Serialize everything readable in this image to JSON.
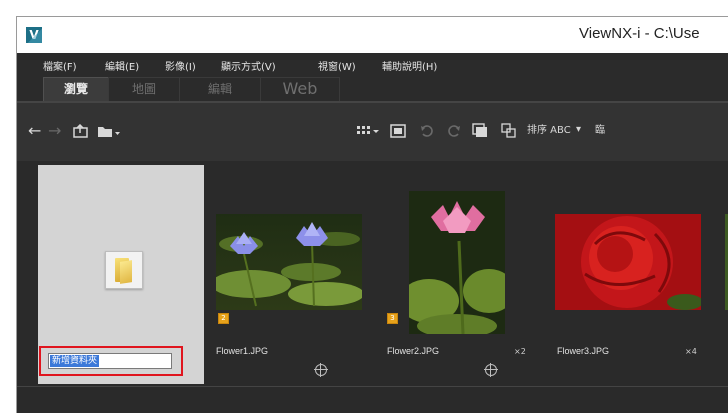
{
  "window": {
    "title": "ViewNX-i - C:\\Use"
  },
  "menu": [
    "檔案(F)",
    "編輯(E)",
    "影像(I)",
    "顯示方式(V)",
    "視窗(W)",
    "輔助說明(H)"
  ],
  "tabs": [
    {
      "label": "瀏覽",
      "active": true
    },
    {
      "label": "地圖",
      "active": false
    },
    {
      "label": "編輯",
      "active": false
    },
    {
      "label": "Web",
      "active": false
    }
  ],
  "toolbar": {
    "back": "←",
    "forward": "→",
    "sort_label": "排序 ABC",
    "grid_dropdown": "▾",
    "truncated": "臨"
  },
  "folder": {
    "rename_value": "新增資料夾"
  },
  "thumbnails": [
    {
      "filename": "Flower1.JPG",
      "badge": "2",
      "seq": "",
      "has_gps": true
    },
    {
      "filename": "Flower2.JPG",
      "badge": "3",
      "seq": "×2",
      "has_gps": true
    },
    {
      "filename": "Flower3.JPG",
      "badge": "",
      "seq": "×4",
      "has_gps": false
    }
  ]
}
